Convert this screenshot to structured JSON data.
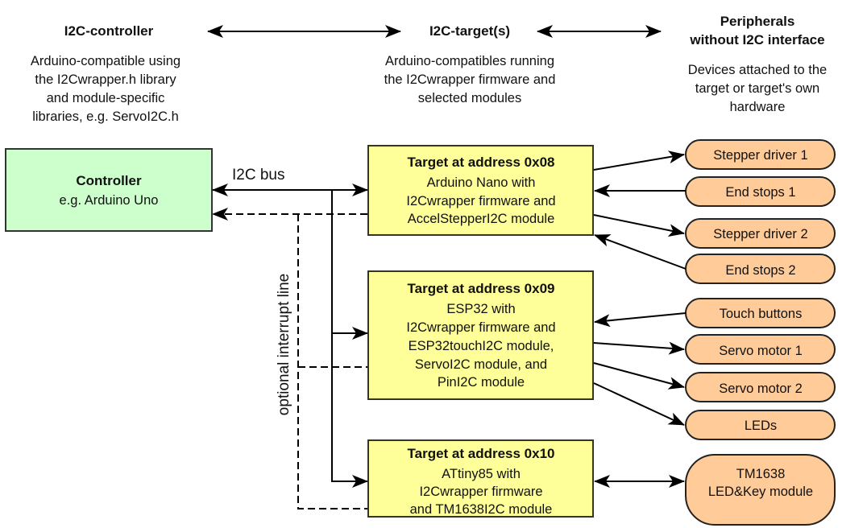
{
  "header": {
    "controller": {
      "title": "I2C-controller",
      "description": [
        "Arduino-compatible using",
        "the I2Cwrapper.h library",
        "and module-specific",
        "libraries, e.g. ServoI2C.h"
      ]
    },
    "targets": {
      "title": "I2C-target(s)",
      "description": [
        "Arduino-compatibles running",
        "the I2Cwrapper firmware and",
        "selected modules"
      ]
    },
    "peripherals": {
      "title": [
        "Peripherals",
        "without I2C interface"
      ],
      "description": [
        "Devices attached to the",
        "target or target's own",
        "hardware"
      ]
    }
  },
  "controller_box": {
    "title": "Controller",
    "subtitle": "e.g. Arduino Uno",
    "color": "#ccffcc"
  },
  "bus_label": "I2C bus",
  "interrupt_label": "optional interrupt line",
  "targets": [
    {
      "title": "Target at address 0x08",
      "lines": [
        "Arduino Nano with",
        "I2Cwrapper firmware and",
        "AccelStepperI2C module"
      ]
    },
    {
      "title": "Target at address 0x09",
      "lines": [
        "ESP32 with",
        "I2Cwrapper firmware and",
        "ESP32touchI2C module,",
        "ServoI2C module, and",
        "PinI2C module"
      ]
    },
    {
      "title": "Target at address 0x10",
      "lines": [
        "ATtiny85 with",
        "I2Cwrapper firmware",
        "and TM1638I2C module"
      ]
    }
  ],
  "target_color": "#ffff99",
  "peripherals": [
    {
      "label": [
        "Stepper driver 1"
      ],
      "direction": "to-peripheral"
    },
    {
      "label": [
        "End stops 1"
      ],
      "direction": "to-target"
    },
    {
      "label": [
        "Stepper driver 2"
      ],
      "direction": "to-peripheral"
    },
    {
      "label": [
        "End stops 2"
      ],
      "direction": "to-target"
    },
    {
      "label": [
        "Touch buttons"
      ],
      "direction": "to-target"
    },
    {
      "label": [
        "Servo motor 1"
      ],
      "direction": "to-peripheral"
    },
    {
      "label": [
        "Servo motor 2"
      ],
      "direction": "to-peripheral"
    },
    {
      "label": [
        "LEDs"
      ],
      "direction": "to-peripheral"
    },
    {
      "label": [
        "TM1638",
        "LED&Key module"
      ],
      "direction": "bidirectional"
    }
  ],
  "peripheral_color": "#ffcc99"
}
